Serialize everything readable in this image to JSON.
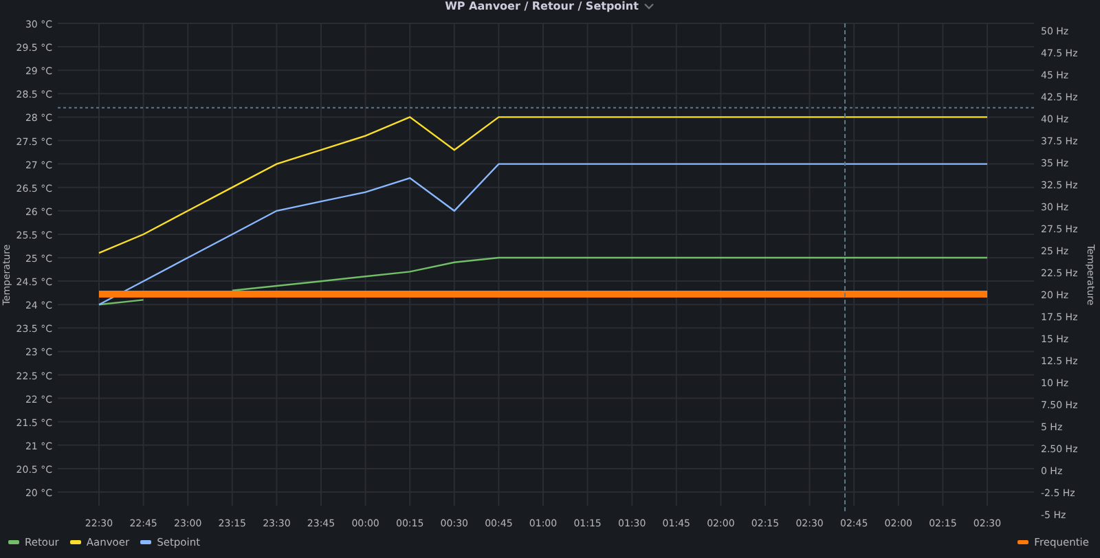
{
  "panel": {
    "title": "WP Aanvoer / Retour / Setpoint",
    "chart_data": {
      "type": "line",
      "grid": true,
      "ref_lines": [
        {
          "axis": "y",
          "value": 28.2
        }
      ],
      "ylabel": "Temperature",
      "y2label": "Temperature",
      "categories": [
        "22:30",
        "22:45",
        "23:00",
        "23:15",
        "23:30",
        "23:45",
        "00:00",
        "00:15",
        "00:30",
        "00:45",
        "01:00",
        "01:15",
        "01:30",
        "01:45",
        "02:00",
        "02:15",
        "02:30",
        "02:45",
        "02:00",
        "02:15",
        "02:30"
      ],
      "ylim": [
        20,
        30
      ],
      "yticks": [
        {
          "value": 20,
          "label": "20 °C"
        },
        {
          "value": 20.5,
          "label": "20.5 °C"
        },
        {
          "value": 21,
          "label": "21 °C"
        },
        {
          "value": 21.5,
          "label": "21.5 °C"
        },
        {
          "value": 22,
          "label": "22 °C"
        },
        {
          "value": 22.5,
          "label": "22.5 °C"
        },
        {
          "value": 23,
          "label": "23 °C"
        },
        {
          "value": 23.5,
          "label": "23.5 °C"
        },
        {
          "value": 24,
          "label": "24 °C"
        },
        {
          "value": 24.5,
          "label": "24.5 °C"
        },
        {
          "value": 25,
          "label": "25 °C"
        },
        {
          "value": 25.5,
          "label": "25.5 °C"
        },
        {
          "value": 26,
          "label": "26 °C"
        },
        {
          "value": 26.5,
          "label": "26.5 °C"
        },
        {
          "value": 27,
          "label": "27 °C"
        },
        {
          "value": 27.5,
          "label": "27.5 °C"
        },
        {
          "value": 28,
          "label": "28 °C"
        },
        {
          "value": 28.5,
          "label": "28.5 °C"
        },
        {
          "value": 29,
          "label": "29 °C"
        },
        {
          "value": 29.5,
          "label": "29.5 °C"
        },
        {
          "value": 30,
          "label": "30 °C"
        }
      ],
      "y2lim": [
        -5,
        50
      ],
      "y2ticks": [
        {
          "value": -5,
          "label": "-5 Hz"
        },
        {
          "value": -2.5,
          "label": "-2.5 Hz"
        },
        {
          "value": 0,
          "label": "0 Hz"
        },
        {
          "value": 2.5,
          "label": "2.50 Hz"
        },
        {
          "value": 5,
          "label": "5 Hz"
        },
        {
          "value": 7.5,
          "label": "7.50 Hz"
        },
        {
          "value": 10,
          "label": "10 Hz"
        },
        {
          "value": 12.5,
          "label": "12.5 Hz"
        },
        {
          "value": 15,
          "label": "15 Hz"
        },
        {
          "value": 17.5,
          "label": "17.5 Hz"
        },
        {
          "value": 20,
          "label": "20 Hz"
        },
        {
          "value": 22.5,
          "label": "22.5 Hz"
        },
        {
          "value": 25,
          "label": "25 Hz"
        },
        {
          "value": 27.5,
          "label": "27.5 Hz"
        },
        {
          "value": 30,
          "label": "30 Hz"
        },
        {
          "value": 32.5,
          "label": "32.5 Hz"
        },
        {
          "value": 35,
          "label": "35 Hz"
        },
        {
          "value": 37.5,
          "label": "37.5 Hz"
        },
        {
          "value": 40,
          "label": "40 Hz"
        },
        {
          "value": 42.5,
          "label": "42.5 Hz"
        },
        {
          "value": 45,
          "label": "45 Hz"
        },
        {
          "value": 47.5,
          "label": "47.5 Hz"
        },
        {
          "value": 50,
          "label": "50 Hz"
        }
      ],
      "series": [
        {
          "name": "Retour",
          "color": "#73bf69",
          "values": [
            24.0,
            24.1,
            null,
            24.3,
            24.4,
            24.5,
            24.6,
            24.7,
            24.9,
            25,
            25,
            25,
            25,
            25,
            25,
            25,
            25,
            25,
            25,
            25,
            25
          ]
        },
        {
          "name": "Aanvoer",
          "color": "#fade2a",
          "values": [
            25.1,
            25.5,
            26,
            26.5,
            27,
            27.3,
            27.6,
            28,
            27.3,
            28,
            28,
            28,
            28,
            28,
            28,
            28,
            28,
            28,
            28,
            28,
            28
          ]
        },
        {
          "name": "Setpoint",
          "color": "#8ab8ff",
          "values": [
            24,
            24.5,
            25,
            25.5,
            26,
            26.2,
            26.4,
            26.7,
            26,
            27,
            27,
            27,
            27,
            27,
            27,
            27,
            27,
            27,
            27,
            27,
            27
          ]
        },
        {
          "name": "Frequentie",
          "color": "#ff780a",
          "axis": "y2",
          "values": [
            20,
            20,
            20,
            20,
            20,
            20,
            20,
            20,
            20,
            20,
            20,
            20,
            20,
            20,
            20,
            20,
            20,
            20,
            20,
            20,
            20
          ]
        }
      ]
    }
  }
}
